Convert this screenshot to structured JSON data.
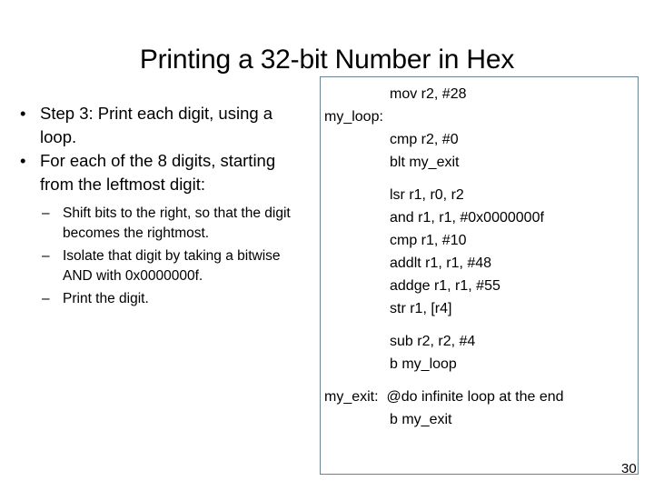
{
  "slide": {
    "title": "Printing a 32-bit Number in Hex",
    "page_number": "30",
    "accent_border_color": "#6b8290",
    "text_color": "#000000",
    "background_color": "#ffffff"
  },
  "bullets": [
    {
      "marker": "•",
      "text": "Step 3: Print each digit, using a loop."
    },
    {
      "marker": "•",
      "text": "For each of the 8 digits, starting from the leftmost digit:"
    }
  ],
  "sub_bullets": [
    {
      "marker": "–",
      "text": "Shift bits to the right, so that the digit becomes the rightmost."
    },
    {
      "marker": "–",
      "text": "Isolate that digit by taking a bitwise AND with 0x0000000f."
    },
    {
      "marker": "–",
      "text": "Print the digit."
    }
  ],
  "code_box": {
    "lines": [
      {
        "type": "indent",
        "text": "mov r2, #28"
      },
      {
        "type": "flush",
        "text": "my_loop:"
      },
      {
        "type": "indent",
        "text": "cmp r2, #0"
      },
      {
        "type": "indent",
        "text": "blt my_exit"
      },
      {
        "type": "gap",
        "text": ""
      },
      {
        "type": "indent",
        "text": "lsr r1, r0, r2"
      },
      {
        "type": "indent",
        "text": "and r1, r1, #0x0000000f"
      },
      {
        "type": "indent",
        "text": "cmp r1, #10"
      },
      {
        "type": "indent",
        "text": "addlt r1, r1, #48"
      },
      {
        "type": "indent",
        "text": "addge r1, r1, #55"
      },
      {
        "type": "indent",
        "text": "str r1, [r4]"
      },
      {
        "type": "gap",
        "text": ""
      },
      {
        "type": "indent",
        "text": "sub r2, r2, #4"
      },
      {
        "type": "indent",
        "text": "b my_loop"
      },
      {
        "type": "gap",
        "text": ""
      },
      {
        "type": "flush",
        "text": "my_exit:  @do infinite loop at the end"
      },
      {
        "type": "indent",
        "text": "b my_exit"
      }
    ]
  }
}
